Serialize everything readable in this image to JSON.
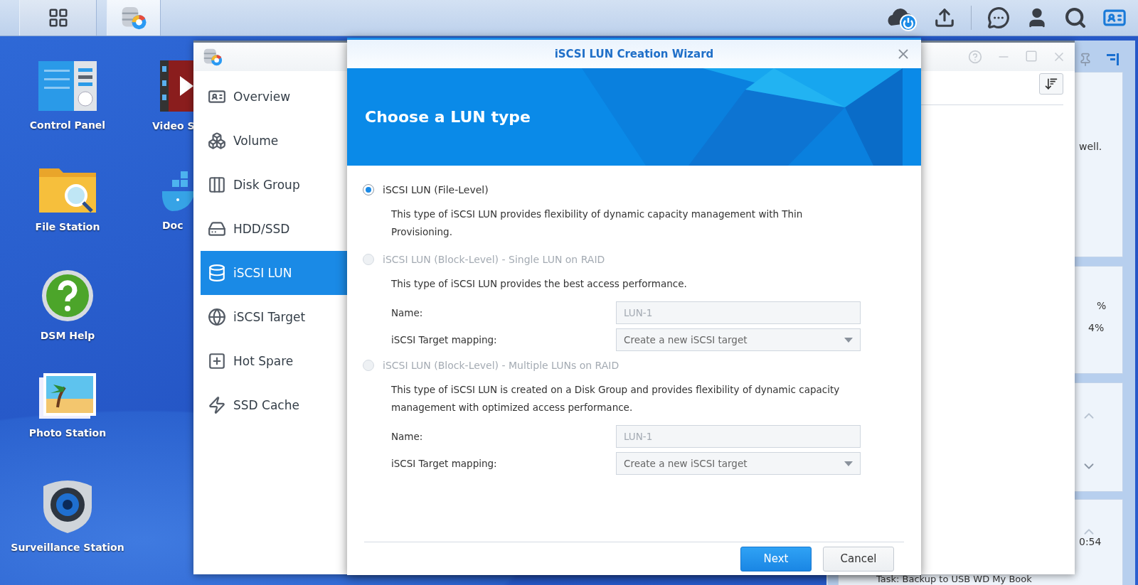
{
  "taskbar": {
    "buttons": [
      {
        "kind": "apps",
        "selected": false
      },
      {
        "kind": "storage",
        "selected": true
      }
    ]
  },
  "desktop_icons": [
    {
      "label": "Control Panel",
      "kind": "control"
    },
    {
      "label": "File Station",
      "kind": "file"
    },
    {
      "label": "DSM Help",
      "kind": "help"
    },
    {
      "label": "Photo Station",
      "kind": "photo"
    },
    {
      "label": "Surveillance Station",
      "kind": "camera"
    }
  ],
  "desktop_icons_partial": [
    {
      "label": "Video S",
      "kind": "video"
    },
    {
      "label": "Doc",
      "kind": "docker"
    }
  ],
  "widgets": {
    "texts": [
      "well.",
      "%",
      "4%",
      "0:54"
    ],
    "footer_text": "Task: Backup to USB WD My Book"
  },
  "storage_manager": {
    "nav": [
      {
        "label": "Overview",
        "kind": "overview",
        "selected": false
      },
      {
        "label": "Volume",
        "kind": "volume",
        "selected": false
      },
      {
        "label": "Disk Group",
        "kind": "diskgroup",
        "selected": false
      },
      {
        "label": "HDD/SSD",
        "kind": "hdd",
        "selected": false
      },
      {
        "label": "iSCSI LUN",
        "kind": "lun",
        "selected": true
      },
      {
        "label": "iSCSI Target",
        "kind": "target",
        "selected": false
      },
      {
        "label": "Hot Spare",
        "kind": "spare",
        "selected": false
      },
      {
        "label": "SSD Cache",
        "kind": "cache",
        "selected": false
      }
    ]
  },
  "wizard": {
    "title": "iSCSI LUN Creation Wizard",
    "heading": "Choose a LUN type",
    "options": [
      {
        "label": "iSCSI LUN (File-Level)",
        "selected": true,
        "disabled": false,
        "description": "This type of iSCSI LUN provides flexibility of dynamic capacity management with Thin Provisioning."
      },
      {
        "label": "iSCSI LUN (Block-Level) - Single LUN on RAID",
        "selected": false,
        "disabled": true,
        "description": "This type of iSCSI LUN provides the best access performance.",
        "fields": [
          {
            "label": "Name:",
            "value": "LUN-1",
            "kind": "text"
          },
          {
            "label": "iSCSI Target mapping:",
            "value": "Create a new iSCSI target",
            "kind": "select"
          }
        ]
      },
      {
        "label": "iSCSI LUN (Block-Level) - Multiple LUNs on RAID",
        "selected": false,
        "disabled": true,
        "description": "This type of iSCSI LUN is created on a Disk Group and provides flexibility of dynamic capacity management with optimized access performance.",
        "fields": [
          {
            "label": "Name:",
            "value": "LUN-1",
            "kind": "text"
          },
          {
            "label": "iSCSI Target mapping:",
            "value": "Create a new iSCSI target",
            "kind": "select"
          }
        ]
      }
    ],
    "buttons": [
      {
        "label": "Next",
        "kind": "primary"
      },
      {
        "label": "Cancel",
        "kind": "secondary"
      }
    ]
  }
}
